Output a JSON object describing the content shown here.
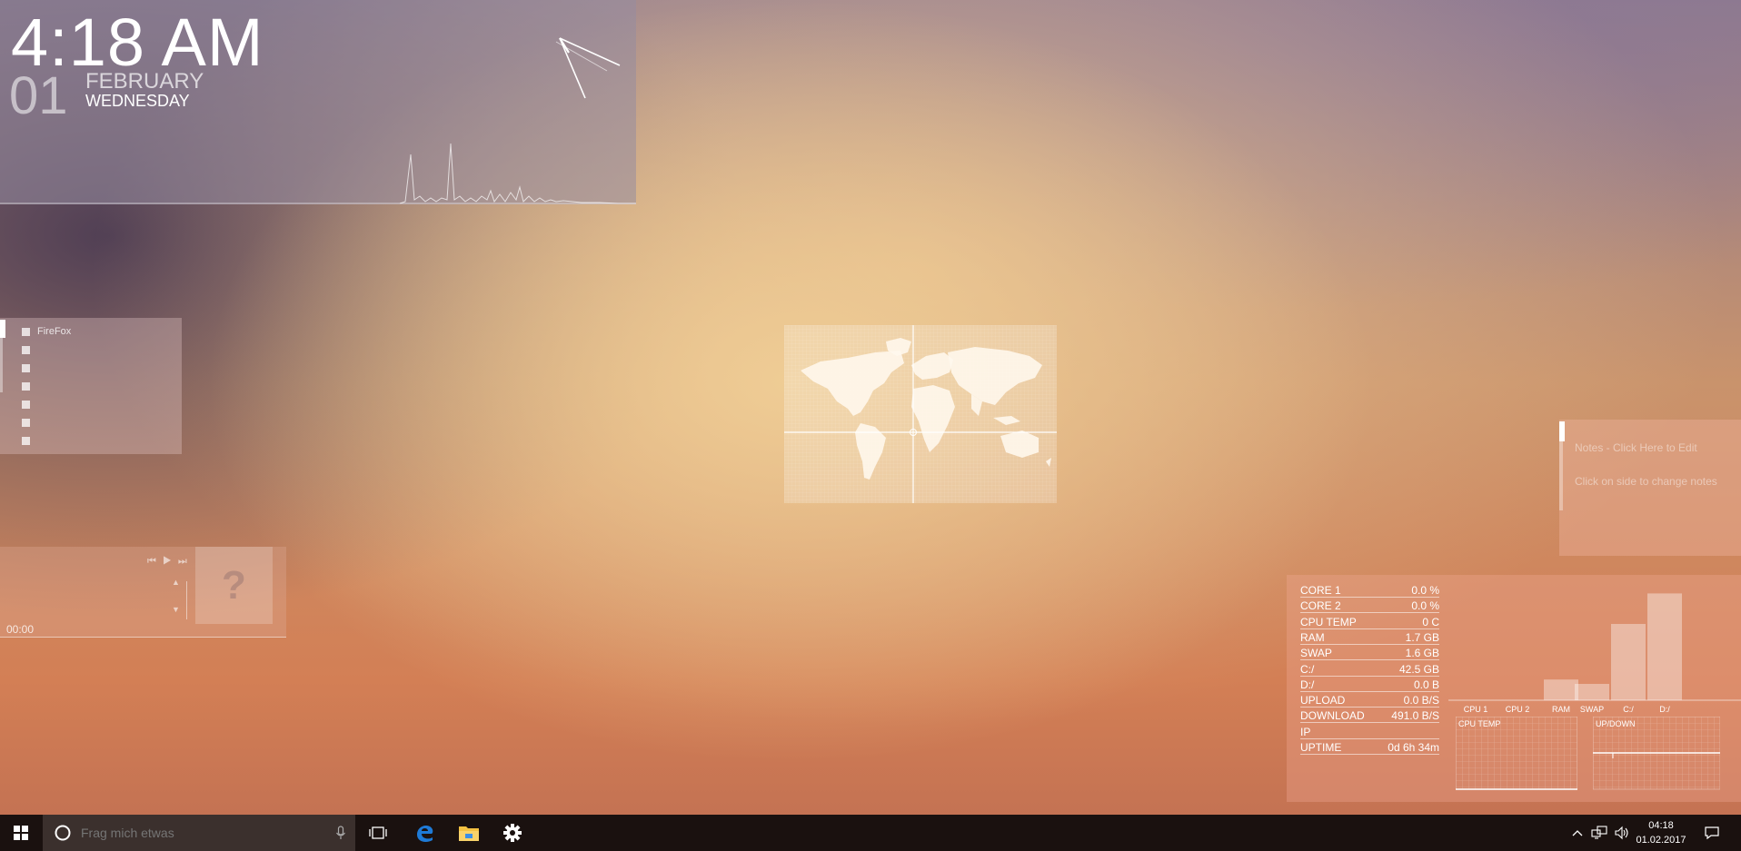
{
  "clock": {
    "time": "4:18 AM",
    "day": "01",
    "month": "FEBRUARY",
    "weekday": "WEDNESDAY"
  },
  "launcher": {
    "items": [
      "FireFox",
      "",
      "",
      "",
      "",
      "",
      ""
    ]
  },
  "player": {
    "time": "00:00",
    "art_placeholder": "?",
    "controls": "⏮ ▶ ⏭",
    "volume_up": "▲",
    "volume_down": "▼"
  },
  "notes": {
    "title": "Notes - Click Here to Edit",
    "hint": "Click on side to change notes"
  },
  "sysmon": {
    "stats": [
      {
        "label": "CORE 1",
        "value": "0.0 %"
      },
      {
        "label": "CORE 2",
        "value": "0.0 %"
      },
      {
        "label": "CPU TEMP",
        "value": "0 C"
      },
      {
        "label": "RAM",
        "value": "1.7 GB"
      },
      {
        "label": "SWAP",
        "value": "1.6 GB"
      },
      {
        "label": "C:/",
        "value": "42.5 GB"
      },
      {
        "label": "D:/",
        "value": "0.0 B"
      },
      {
        "label": "UPLOAD",
        "value": "0.0 B/S"
      },
      {
        "label": "DOWNLOAD",
        "value": "491.0 B/S"
      },
      {
        "label": "IP",
        "value": ""
      },
      {
        "label": "UPTIME",
        "value": "0d 6h 34m"
      }
    ],
    "bars": {
      "labels": [
        "CPU 1",
        "CPU 2",
        "RAM",
        "SWAP",
        "C:/",
        "D:/"
      ],
      "values": [
        0,
        0,
        0.19,
        0.15,
        0.7,
        0.98
      ]
    },
    "graph_cpu_label": "CPU TEMP",
    "graph_net_label": "UP/DOWN"
  },
  "taskbar": {
    "search_placeholder": "Frag mich etwas",
    "icons": [
      "task-view-icon",
      "edge-icon",
      "file-explorer-icon",
      "settings-gear-icon"
    ],
    "tray_time": "04:18",
    "tray_date": "01.02.2017"
  },
  "colors": {
    "taskbar": "#1a110f",
    "search_box": "#3b302d",
    "edge_blue": "#1e7ad6",
    "explorer_yellow": "#f4c242"
  }
}
